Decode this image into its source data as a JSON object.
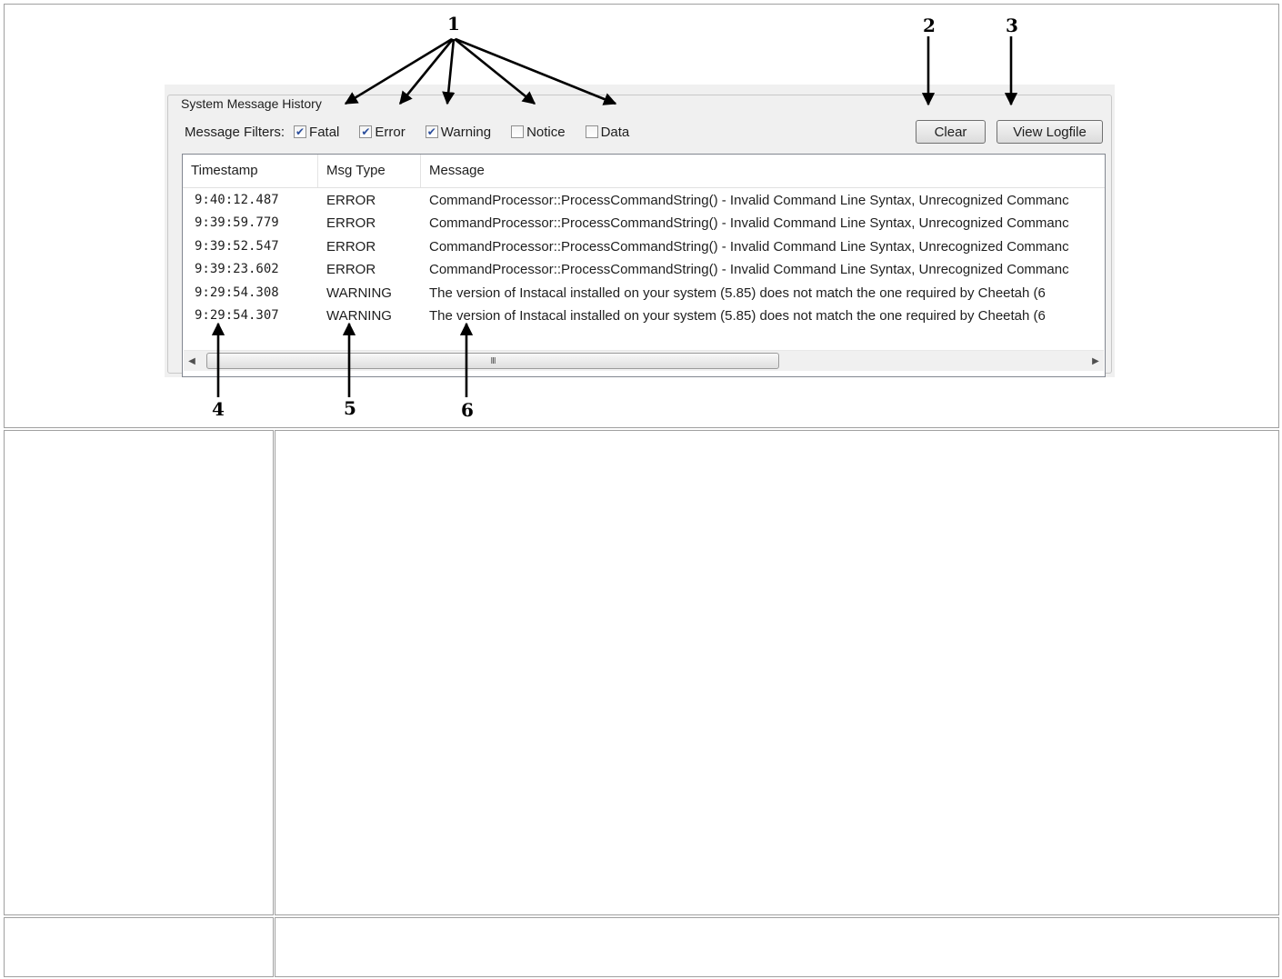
{
  "callouts": [
    "1",
    "2",
    "3",
    "4",
    "5",
    "6"
  ],
  "panel": {
    "group_title": "System Message History",
    "filters_label": "Message Filters:",
    "filters": [
      {
        "label": "Fatal",
        "checked": true
      },
      {
        "label": "Error",
        "checked": true
      },
      {
        "label": "Warning",
        "checked": true
      },
      {
        "label": "Notice",
        "checked": false
      },
      {
        "label": "Data",
        "checked": false
      }
    ],
    "clear_label": "Clear",
    "logfile_label": "View Logfile",
    "columns": [
      "Timestamp",
      "Msg Type",
      "Message"
    ],
    "rows": [
      {
        "ts": "9:40:12.487",
        "type": "ERROR",
        "msg": "CommandProcessor::ProcessCommandString() - Invalid Command Line Syntax, Unrecognized Commanc"
      },
      {
        "ts": "9:39:59.779",
        "type": "ERROR",
        "msg": "CommandProcessor::ProcessCommandString() - Invalid Command Line Syntax, Unrecognized Commanc"
      },
      {
        "ts": "9:39:52.547",
        "type": "ERROR",
        "msg": "CommandProcessor::ProcessCommandString() - Invalid Command Line Syntax, Unrecognized Commanc"
      },
      {
        "ts": "9:39:23.602",
        "type": "ERROR",
        "msg": "CommandProcessor::ProcessCommandString() - Invalid Command Line Syntax, Unrecognized Commanc"
      },
      {
        "ts": "9:29:54.308",
        "type": "WARNING",
        "msg": "The version of Instacal installed on your system (5.85) does not match the one required by Cheetah (6"
      },
      {
        "ts": "9:29:54.307",
        "type": "WARNING",
        "msg": "The version of Instacal installed on your system (5.85) does not match the one required by Cheetah (6"
      }
    ],
    "scroll_grip": "III",
    "scroll_position": 0.0
  },
  "colors": {
    "border": "#a0a0a0",
    "panel_bg": "#f0f0f0",
    "check": "#2a4d9c"
  }
}
